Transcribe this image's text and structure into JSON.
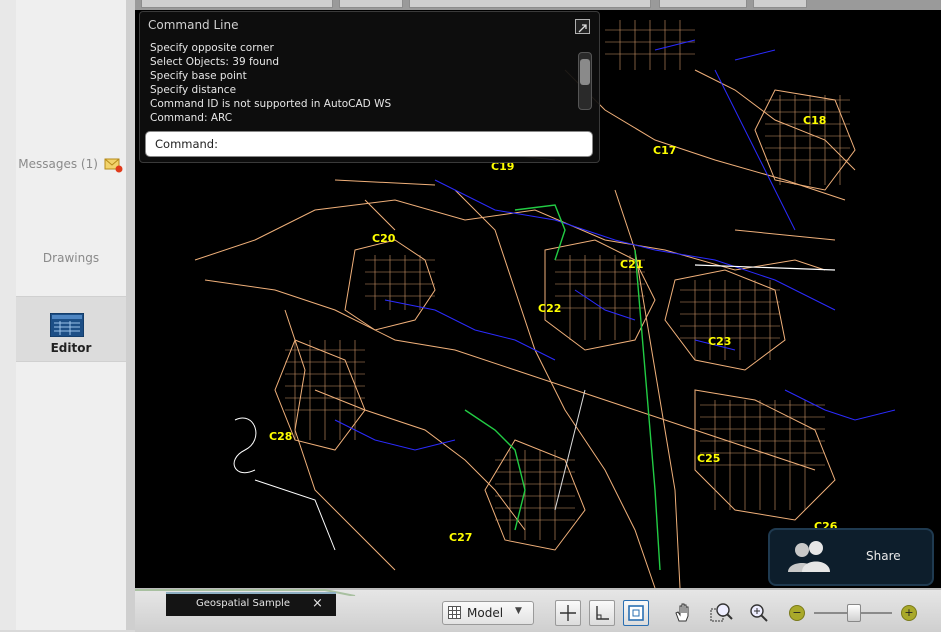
{
  "sidebar": {
    "items": [
      {
        "label": "Messages (1)"
      },
      {
        "label": "Drawings"
      },
      {
        "label": "Editor"
      }
    ]
  },
  "command_line": {
    "title": "Command Line",
    "log": [
      "Specify opposite corner",
      "Select Objects: 39 found",
      "Specify base point",
      "Specify distance",
      "Command ID is not supported in AutoCAD WS",
      "Command: ARC"
    ],
    "prompt_label": "Command:"
  },
  "map": {
    "labels": [
      {
        "text": "C20"
      },
      {
        "text": "C21"
      },
      {
        "text": "C22"
      },
      {
        "text": "C23"
      },
      {
        "text": "C25"
      },
      {
        "text": "C26"
      },
      {
        "text": "C27"
      },
      {
        "text": "C28"
      },
      {
        "text": "C19"
      },
      {
        "text": "C17"
      },
      {
        "text": "C18"
      }
    ]
  },
  "share": {
    "label": "Share"
  },
  "bottom": {
    "tab_name": "Geospatial Sample",
    "tab_close": "×",
    "model_label": "Model",
    "zoom_minus": "−",
    "zoom_plus": "+"
  },
  "colors": {
    "map_background": "#000000",
    "streets": "#f0b07a",
    "water": "#2b2bff",
    "labels": "#ffff00",
    "accent_green": "#22cc44"
  }
}
